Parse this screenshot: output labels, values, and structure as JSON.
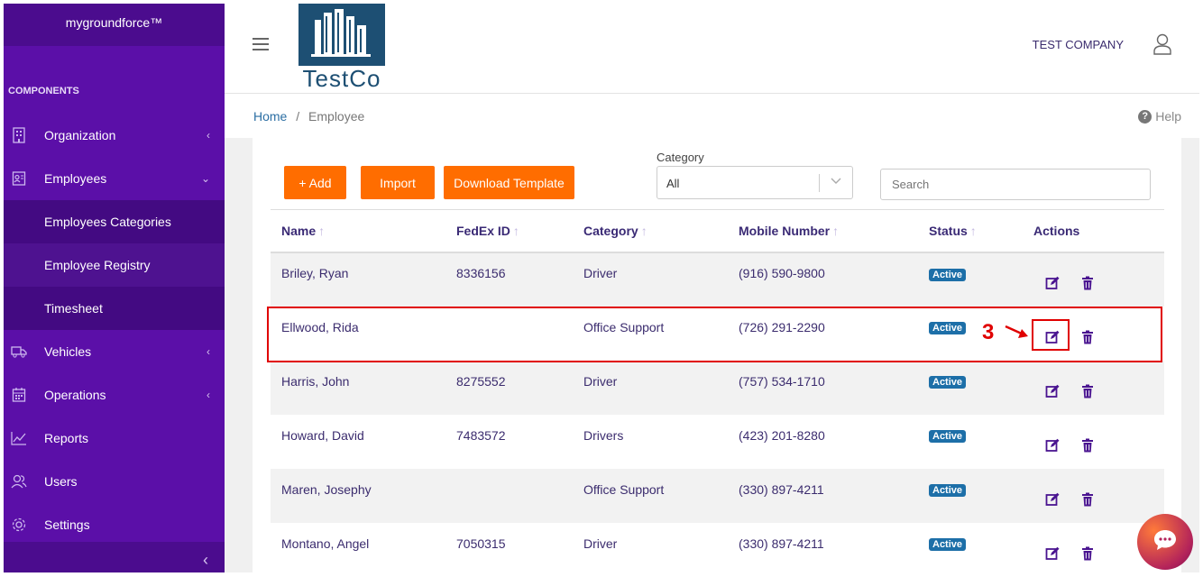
{
  "sidebar": {
    "brand": "mygroundforce™",
    "section_label": "COMPONENTS",
    "items": [
      {
        "label": "Organization",
        "icon": "building-icon",
        "chevron": "‹"
      },
      {
        "label": "Employees",
        "icon": "id-card-icon",
        "chevron": "⌄"
      },
      {
        "label": "Vehicles",
        "icon": "truck-icon",
        "chevron": "‹"
      },
      {
        "label": "Operations",
        "icon": "calendar-icon",
        "chevron": "‹"
      },
      {
        "label": "Reports",
        "icon": "chart-line-icon",
        "chevron": ""
      },
      {
        "label": "Users",
        "icon": "users-icon",
        "chevron": ""
      },
      {
        "label": "Settings",
        "icon": "gear-icon",
        "chevron": ""
      }
    ],
    "sub_items": [
      {
        "label": "Employees Categories"
      },
      {
        "label": "Employee Registry",
        "active": true
      },
      {
        "label": "Timesheet"
      }
    ],
    "collapse_glyph": "‹"
  },
  "header": {
    "logo_text": "TestCo",
    "company_name": "TEST COMPANY"
  },
  "breadcrumb": {
    "home": "Home",
    "separator": "/",
    "current": "Employee"
  },
  "help_label": "Help",
  "toolbar": {
    "add_label": "+ Add",
    "import_label": "Import",
    "download_label": "Download Template",
    "category_label": "Category",
    "category_value": "All",
    "search_placeholder": "Search"
  },
  "table": {
    "columns": [
      "Name",
      "FedEx ID",
      "Category",
      "Mobile Number",
      "Status",
      "Actions"
    ],
    "rows": [
      {
        "name": "Briley, Ryan",
        "fedex": "8336156",
        "category": "Driver",
        "mobile": "(916) 590-9800",
        "status": "Active"
      },
      {
        "name": "Ellwood, Rida",
        "fedex": "",
        "category": "Office Support",
        "mobile": "(726) 291-2290",
        "status": "Active"
      },
      {
        "name": "Harris, John",
        "fedex": "8275552",
        "category": "Driver",
        "mobile": "(757) 534-1710",
        "status": "Active"
      },
      {
        "name": "Howard, David",
        "fedex": "7483572",
        "category": "Drivers",
        "mobile": "(423) 201-8280",
        "status": "Active"
      },
      {
        "name": "Maren, Josephy",
        "fedex": "",
        "category": "Office Support",
        "mobile": "(330) 897-4211",
        "status": "Active"
      },
      {
        "name": "Montano, Angel",
        "fedex": "7050315",
        "category": "Driver",
        "mobile": "(330) 897-4211",
        "status": "Active"
      }
    ]
  },
  "annotation": {
    "step_number": "3",
    "color": "#e00000"
  },
  "colors": {
    "sidebar": "#5b0fa8",
    "accent": "#ff6d00",
    "badge": "#1d6fa8",
    "icon_purple": "#4a1490"
  }
}
